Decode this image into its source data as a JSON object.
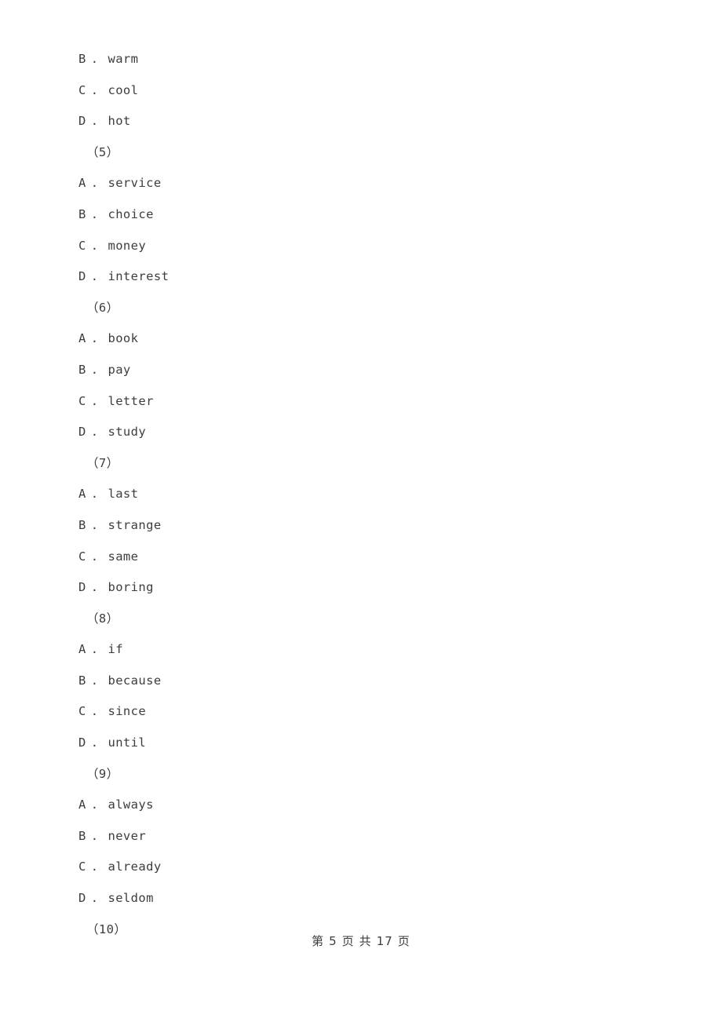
{
  "document": {
    "page_background": "#ffffff",
    "text_color": "#3d3d3d"
  },
  "body_lines": [
    {
      "kind": "option",
      "tag": "B",
      "sep": ".",
      "text": "warm"
    },
    {
      "kind": "option",
      "tag": "C",
      "sep": ".",
      "text": "cool"
    },
    {
      "kind": "option",
      "tag": "D",
      "sep": ".",
      "text": "hot"
    },
    {
      "kind": "qnum",
      "text": "（5）"
    },
    {
      "kind": "option",
      "tag": "A",
      "sep": ".",
      "text": "service"
    },
    {
      "kind": "option",
      "tag": "B",
      "sep": ".",
      "text": "choice"
    },
    {
      "kind": "option",
      "tag": "C",
      "sep": ".",
      "text": "money"
    },
    {
      "kind": "option",
      "tag": "D",
      "sep": ".",
      "text": "interest"
    },
    {
      "kind": "qnum",
      "text": "（6）"
    },
    {
      "kind": "option",
      "tag": "A",
      "sep": ".",
      "text": "book"
    },
    {
      "kind": "option",
      "tag": "B",
      "sep": ".",
      "text": "pay"
    },
    {
      "kind": "option",
      "tag": "C",
      "sep": ".",
      "text": "letter"
    },
    {
      "kind": "option",
      "tag": "D",
      "sep": ".",
      "text": "study"
    },
    {
      "kind": "qnum",
      "text": "（7）"
    },
    {
      "kind": "option",
      "tag": "A",
      "sep": ".",
      "text": "last"
    },
    {
      "kind": "option",
      "tag": "B",
      "sep": ".",
      "text": "strange"
    },
    {
      "kind": "option",
      "tag": "C",
      "sep": ".",
      "text": "same"
    },
    {
      "kind": "option",
      "tag": "D",
      "sep": ".",
      "text": "boring"
    },
    {
      "kind": "qnum",
      "text": "（8）"
    },
    {
      "kind": "option",
      "tag": "A",
      "sep": ".",
      "text": "if"
    },
    {
      "kind": "option",
      "tag": "B",
      "sep": ".",
      "text": "because"
    },
    {
      "kind": "option",
      "tag": "C",
      "sep": ".",
      "text": "since"
    },
    {
      "kind": "option",
      "tag": "D",
      "sep": ".",
      "text": "until"
    },
    {
      "kind": "qnum",
      "text": "（9）"
    },
    {
      "kind": "option",
      "tag": "A",
      "sep": ".",
      "text": "always"
    },
    {
      "kind": "option",
      "tag": "B",
      "sep": ".",
      "text": "never"
    },
    {
      "kind": "option",
      "tag": "C",
      "sep": ".",
      "text": "already"
    },
    {
      "kind": "option",
      "tag": "D",
      "sep": ".",
      "text": "seldom"
    },
    {
      "kind": "qnum",
      "text": "（10）"
    }
  ],
  "footer": {
    "prefix": "第",
    "current_page": "5",
    "page_word": "页",
    "of_word": "共",
    "total_pages": "17",
    "page_word2": "页"
  }
}
